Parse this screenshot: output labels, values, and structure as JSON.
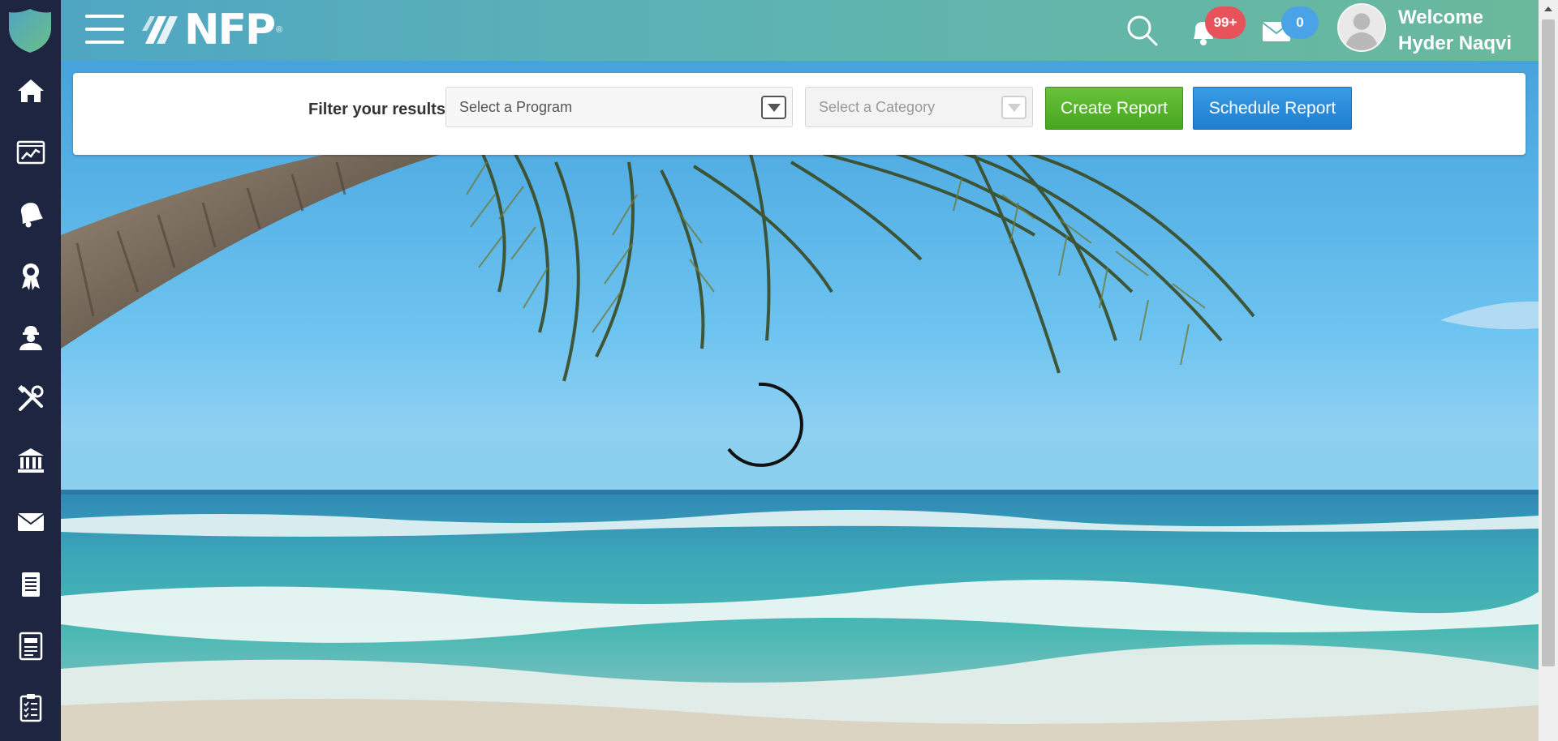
{
  "header": {
    "brand": "NFP",
    "brand_mark": "®",
    "notifications_badge": "99+",
    "messages_badge": "0",
    "welcome_line1": "Welcome",
    "welcome_line2": "Hyder Naqvi"
  },
  "filter": {
    "label": "Filter your results",
    "program_placeholder": "Select a Program",
    "category_placeholder": "Select a Category",
    "create_label": "Create Report",
    "schedule_label": "Schedule Report"
  },
  "sidebar": {
    "items": [
      {
        "name": "home",
        "icon": "home-icon"
      },
      {
        "name": "dashboard",
        "icon": "chart-monitor-icon"
      },
      {
        "name": "alerts",
        "icon": "bell-icon"
      },
      {
        "name": "rewards",
        "icon": "ribbon-icon"
      },
      {
        "name": "workers",
        "icon": "worker-icon"
      },
      {
        "name": "tools",
        "icon": "tools-icon"
      },
      {
        "name": "institutions",
        "icon": "bank-icon"
      },
      {
        "name": "mail",
        "icon": "envelope-icon"
      },
      {
        "name": "notes",
        "icon": "notepad-icon"
      },
      {
        "name": "reports",
        "icon": "document-icon"
      },
      {
        "name": "checklist",
        "icon": "clipboard-icon"
      }
    ]
  },
  "colors": {
    "sidebar": "#1d2541",
    "topbar_start": "#4fa6c3",
    "topbar_end": "#6ab99c",
    "create_button": "#46a61d",
    "schedule_button": "#1f7ed0",
    "notification_badge": "#e8525a",
    "message_badge": "#4aa3e6"
  },
  "status": {
    "loading": true
  }
}
